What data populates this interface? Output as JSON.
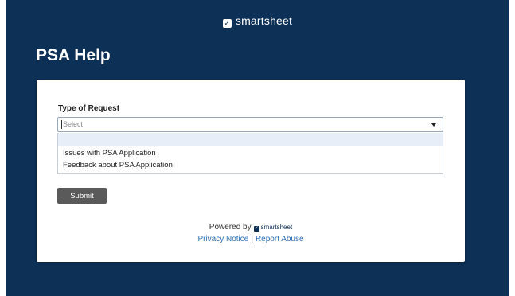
{
  "header": {
    "brand": "smartsheet",
    "page_title": "PSA Help"
  },
  "form": {
    "field_label": "Type of Request",
    "select_placeholder": "Select",
    "options": [
      "Issues with PSA Application",
      "Feedback about PSA Application"
    ],
    "submit_label": "Submit"
  },
  "footer": {
    "powered_by": "Powered by",
    "powered_brand": "smartsheet",
    "privacy_notice": "Privacy Notice",
    "separator": "|",
    "report_abuse": "Report Abuse"
  },
  "colors": {
    "header_bg": "#0d3057",
    "submit_bg": "#5a5a5a",
    "link": "#2a6fb6",
    "option_highlight": "#e8eef8"
  }
}
